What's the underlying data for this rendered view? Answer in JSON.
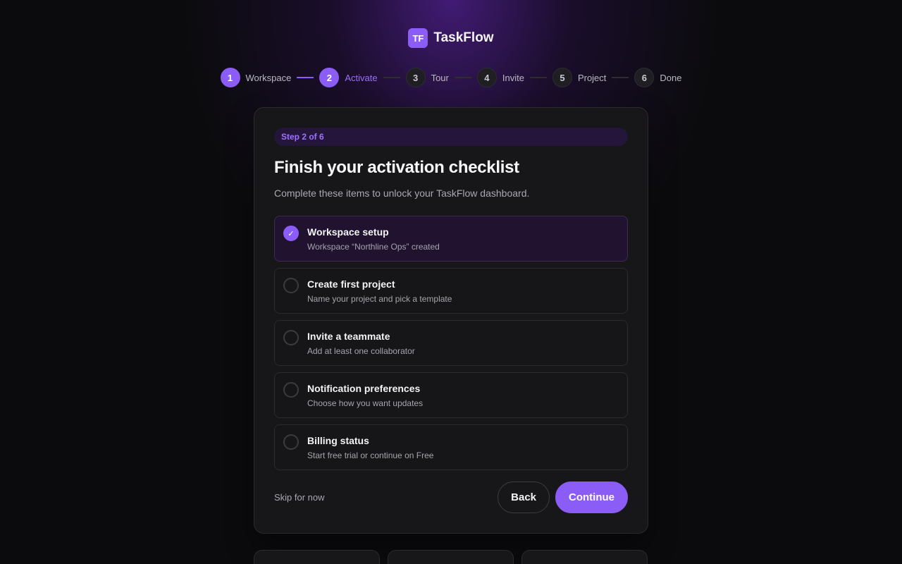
{
  "brand": {
    "logo_text": "TF",
    "name": "TaskFlow",
    "accent": "#8b5cf6"
  },
  "stepper": {
    "steps": [
      {
        "number": "1",
        "label": "Workspace",
        "state": "complete"
      },
      {
        "number": "2",
        "label": "Activate",
        "state": "current"
      },
      {
        "number": "3",
        "label": "Tour",
        "state": "upcoming"
      },
      {
        "number": "4",
        "label": "Invite",
        "state": "upcoming"
      },
      {
        "number": "5",
        "label": "Project",
        "state": "upcoming"
      },
      {
        "number": "6",
        "label": "Done",
        "state": "upcoming"
      }
    ]
  },
  "card": {
    "badge": "Step 2 of 6",
    "title": "Finish your activation checklist",
    "subtitle": "Complete these items to unlock your TaskFlow dashboard.",
    "checklist": [
      {
        "title": "Workspace setup",
        "desc": "Workspace “Northline Ops” created",
        "checked": true,
        "check_glyph": "✓"
      },
      {
        "title": "Create first project",
        "desc": "Name your project and pick a template",
        "checked": false
      },
      {
        "title": "Invite a teammate",
        "desc": "Add at least one collaborator",
        "checked": false
      },
      {
        "title": "Notification preferences",
        "desc": "Choose how you want updates",
        "checked": false
      },
      {
        "title": "Billing status",
        "desc": "Start free trial or continue on Free",
        "checked": false
      }
    ],
    "skip_label": "Skip for now",
    "back_label": "Back",
    "continue_label": "Continue"
  }
}
